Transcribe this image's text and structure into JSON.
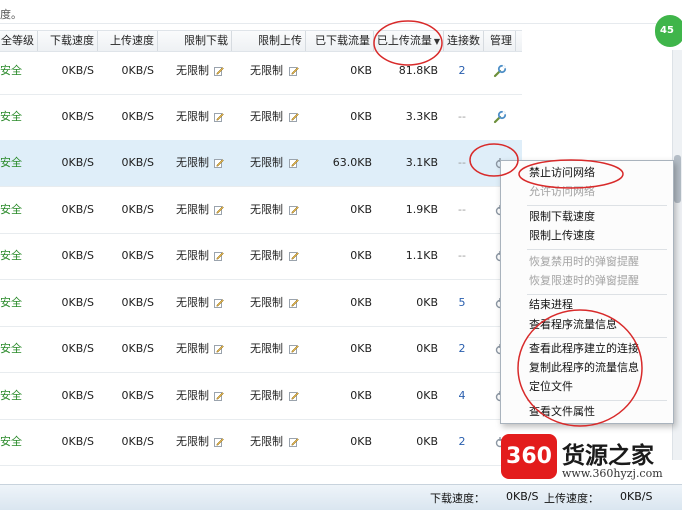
{
  "top_text": "度。",
  "columns": {
    "security": "全等级",
    "download_speed": "下载速度",
    "upload_speed": "上传速度",
    "limit_download": "限制下载",
    "limit_upload": "限制上传",
    "downloaded_traffic": "已下载流量",
    "uploaded_traffic": "已上传流量",
    "connections": "连接数",
    "manage": "管理"
  },
  "rows": [
    {
      "security": "安全",
      "dn": "0KB/S",
      "up": "0KB/S",
      "ld": "无限制",
      "lu": "无限制",
      "dtr": "0KB",
      "utr": "81.8KB",
      "conn": "2"
    },
    {
      "security": "安全",
      "dn": "0KB/S",
      "up": "0KB/S",
      "ld": "无限制",
      "lu": "无限制",
      "dtr": "0KB",
      "utr": "3.3KB",
      "conn": "--"
    },
    {
      "security": "安全",
      "dn": "0KB/S",
      "up": "0KB/S",
      "ld": "无限制",
      "lu": "无限制",
      "dtr": "63.0KB",
      "utr": "3.1KB",
      "conn": "--"
    },
    {
      "security": "安全",
      "dn": "0KB/S",
      "up": "0KB/S",
      "ld": "无限制",
      "lu": "无限制",
      "dtr": "0KB",
      "utr": "1.9KB",
      "conn": "--"
    },
    {
      "security": "安全",
      "dn": "0KB/S",
      "up": "0KB/S",
      "ld": "无限制",
      "lu": "无限制",
      "dtr": "0KB",
      "utr": "1.1KB",
      "conn": "--"
    },
    {
      "security": "安全",
      "dn": "0KB/S",
      "up": "0KB/S",
      "ld": "无限制",
      "lu": "无限制",
      "dtr": "0KB",
      "utr": "0KB",
      "conn": "5"
    },
    {
      "security": "安全",
      "dn": "0KB/S",
      "up": "0KB/S",
      "ld": "无限制",
      "lu": "无限制",
      "dtr": "0KB",
      "utr": "0KB",
      "conn": "2"
    },
    {
      "security": "安全",
      "dn": "0KB/S",
      "up": "0KB/S",
      "ld": "无限制",
      "lu": "无限制",
      "dtr": "0KB",
      "utr": "0KB",
      "conn": "4"
    },
    {
      "security": "安全",
      "dn": "0KB/S",
      "up": "0KB/S",
      "ld": "无限制",
      "lu": "无限制",
      "dtr": "0KB",
      "utr": "0KB",
      "conn": "2"
    }
  ],
  "context_menu": {
    "items": [
      {
        "label": "禁止访问网络",
        "disabled": false
      },
      {
        "label": "允许访问网络",
        "disabled": true
      },
      {
        "label": "限制下载速度",
        "disabled": false
      },
      {
        "label": "限制上传速度",
        "disabled": false
      },
      {
        "label": "恢复禁用时的弹窗提醒",
        "disabled": true
      },
      {
        "label": "恢复限速时的弹窗提醒",
        "disabled": true
      },
      {
        "label": "结束进程",
        "disabled": false
      },
      {
        "label": "查看程序流量信息",
        "disabled": false
      },
      {
        "label": "查看此程序建立的连接",
        "disabled": false
      },
      {
        "label": "复制此程序的流量信息",
        "disabled": false
      },
      {
        "label": "定位文件",
        "disabled": false
      },
      {
        "label": "查看文件属性",
        "disabled": false
      }
    ]
  },
  "status_bar": {
    "download_label": "下载速度：",
    "download_value": "0KB/S",
    "upload_label": "上传速度：",
    "upload_value": "0KB/S"
  },
  "right_badge": "45",
  "watermark": {
    "logo": "360",
    "title": "货源之家",
    "url": "www.360hyzj.com"
  },
  "colors": {
    "security_green": "#2a8a2a",
    "selected_row": "#dfeef9",
    "annotation_red": "#d82a2a",
    "link_blue": "#2a5fae"
  }
}
